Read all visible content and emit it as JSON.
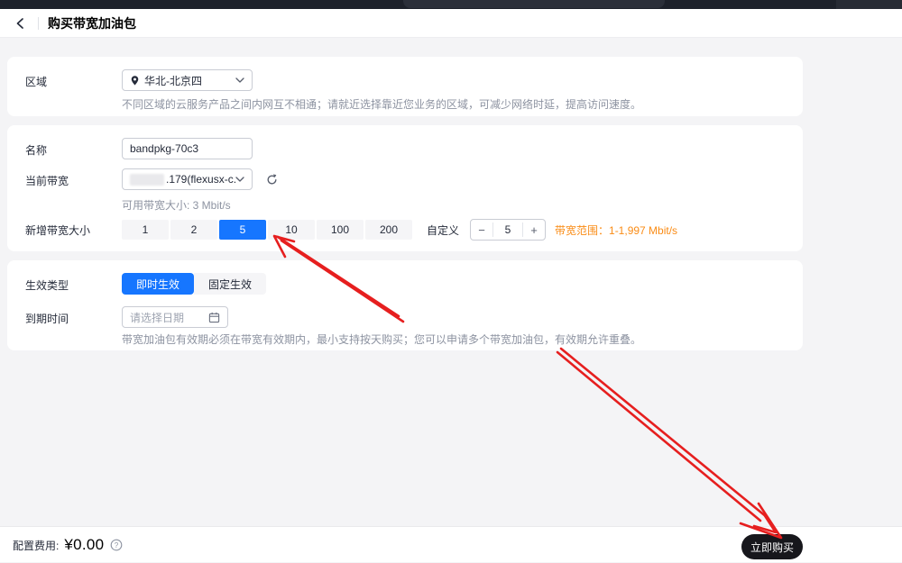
{
  "header": {
    "title": "购买带宽加油包"
  },
  "region_card": {
    "label": "区域",
    "value": "华北-北京四",
    "hint": "不同区域的云服务产品之间内网互不相通；请就近选择靠近您业务的区域，可减少网络时延，提高访问速度。"
  },
  "config_card": {
    "name_label": "名称",
    "name_value": "bandpkg-70c3",
    "bandwidth_label": "当前带宽",
    "bandwidth_value": ".179(flexusx-c...",
    "bandwidth_hint": "可用带宽大小: 3 Mbit/s",
    "size_label": "新增带宽大小",
    "size_options": [
      "1",
      "2",
      "5",
      "10",
      "100",
      "200"
    ],
    "size_selected": "5",
    "custom_label": "自定义",
    "stepper": {
      "minus": "−",
      "value": "5",
      "plus": "+"
    },
    "range_hint": "带宽范围：1-1,997 Mbit/s"
  },
  "effect_card": {
    "type_label": "生效类型",
    "type_options": [
      "即时生效",
      "固定生效"
    ],
    "type_selected": "即时生效",
    "expire_label": "到期时间",
    "date_placeholder": "请选择日期",
    "hint": "带宽加油包有效期必须在带宽有效期内，最小支持按天购买；您可以申请多个带宽加油包，有效期允许重叠。"
  },
  "footer": {
    "cost_label": "配置费用:",
    "cost_value": "¥0.00",
    "buy_button": "立即购买"
  },
  "icons": {
    "back": "‹",
    "location_pin": "pin",
    "chevron_down": "⌄",
    "refresh": "⟳",
    "calendar": "calendar",
    "help": "?",
    "minus": "−",
    "plus": "+"
  },
  "colors": {
    "accent": "#1676ff",
    "range_warning": "#fa8c16",
    "annotation_red": "#e61f1f",
    "buy_black": "#17171c"
  }
}
